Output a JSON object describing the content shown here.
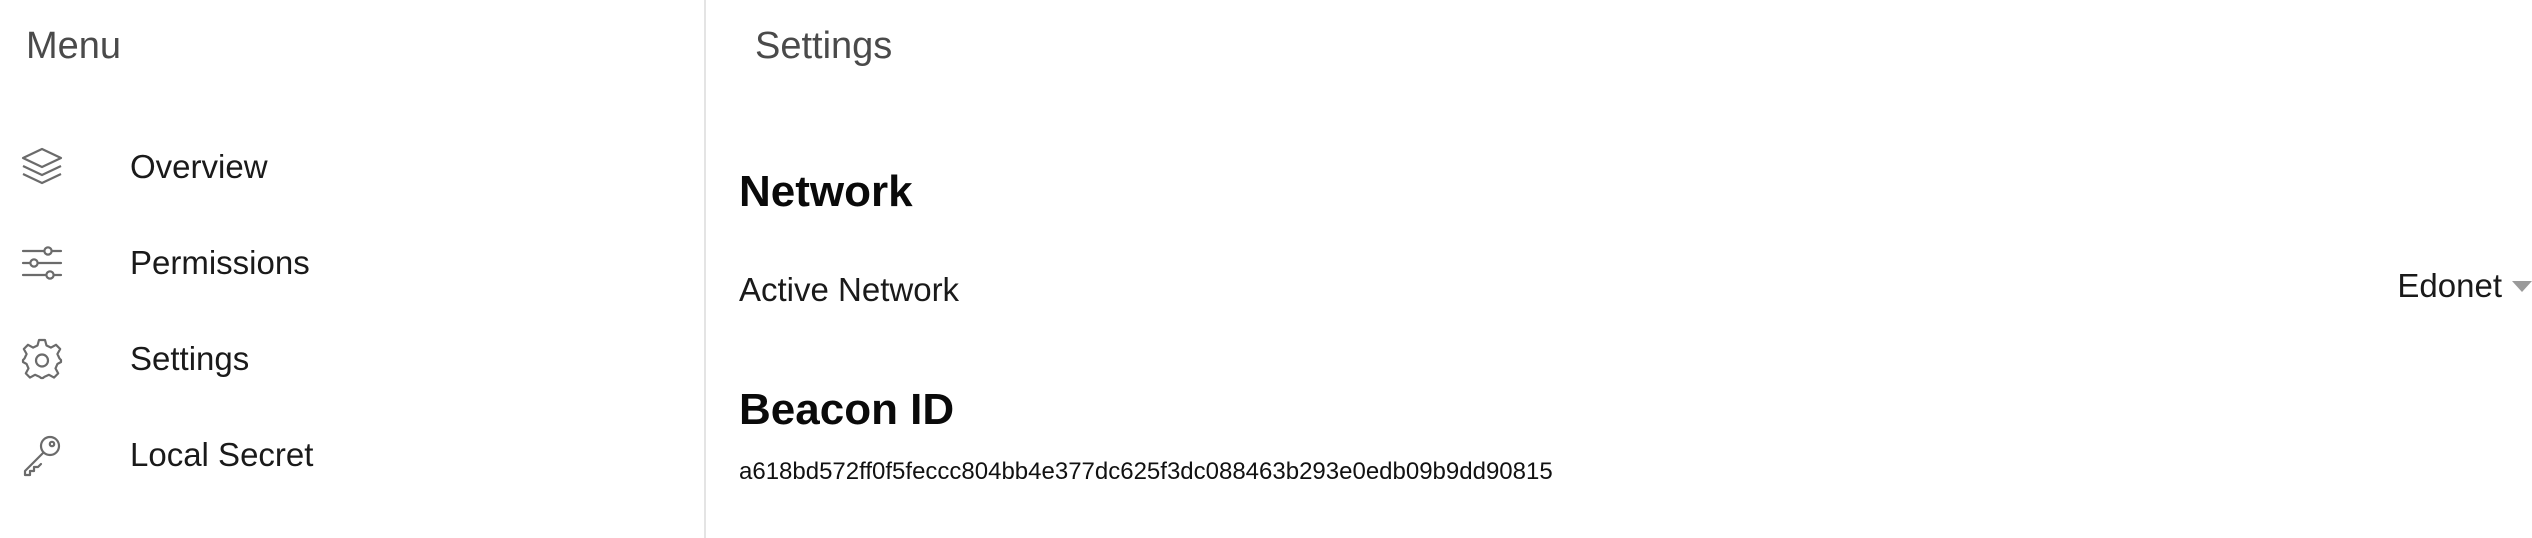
{
  "sidebar": {
    "title": "Menu",
    "items": [
      {
        "label": "Overview",
        "icon": "layers-icon"
      },
      {
        "label": "Permissions",
        "icon": "sliders-icon"
      },
      {
        "label": "Settings",
        "icon": "gear-icon"
      },
      {
        "label": "Local Secret",
        "icon": "key-icon"
      }
    ]
  },
  "main": {
    "title": "Settings",
    "network": {
      "heading": "Network",
      "label": "Active Network",
      "selected": "Edonet"
    },
    "beacon": {
      "heading": "Beacon ID",
      "id": "a618bd572ff0f5feccc804bb4e377dc625f3dc088463b293e0edb09b9dd90815"
    }
  },
  "colors": {
    "icon_stroke": "#6b6b6b",
    "divider": "#e4e4e4",
    "caret": "#9a9a9a"
  }
}
